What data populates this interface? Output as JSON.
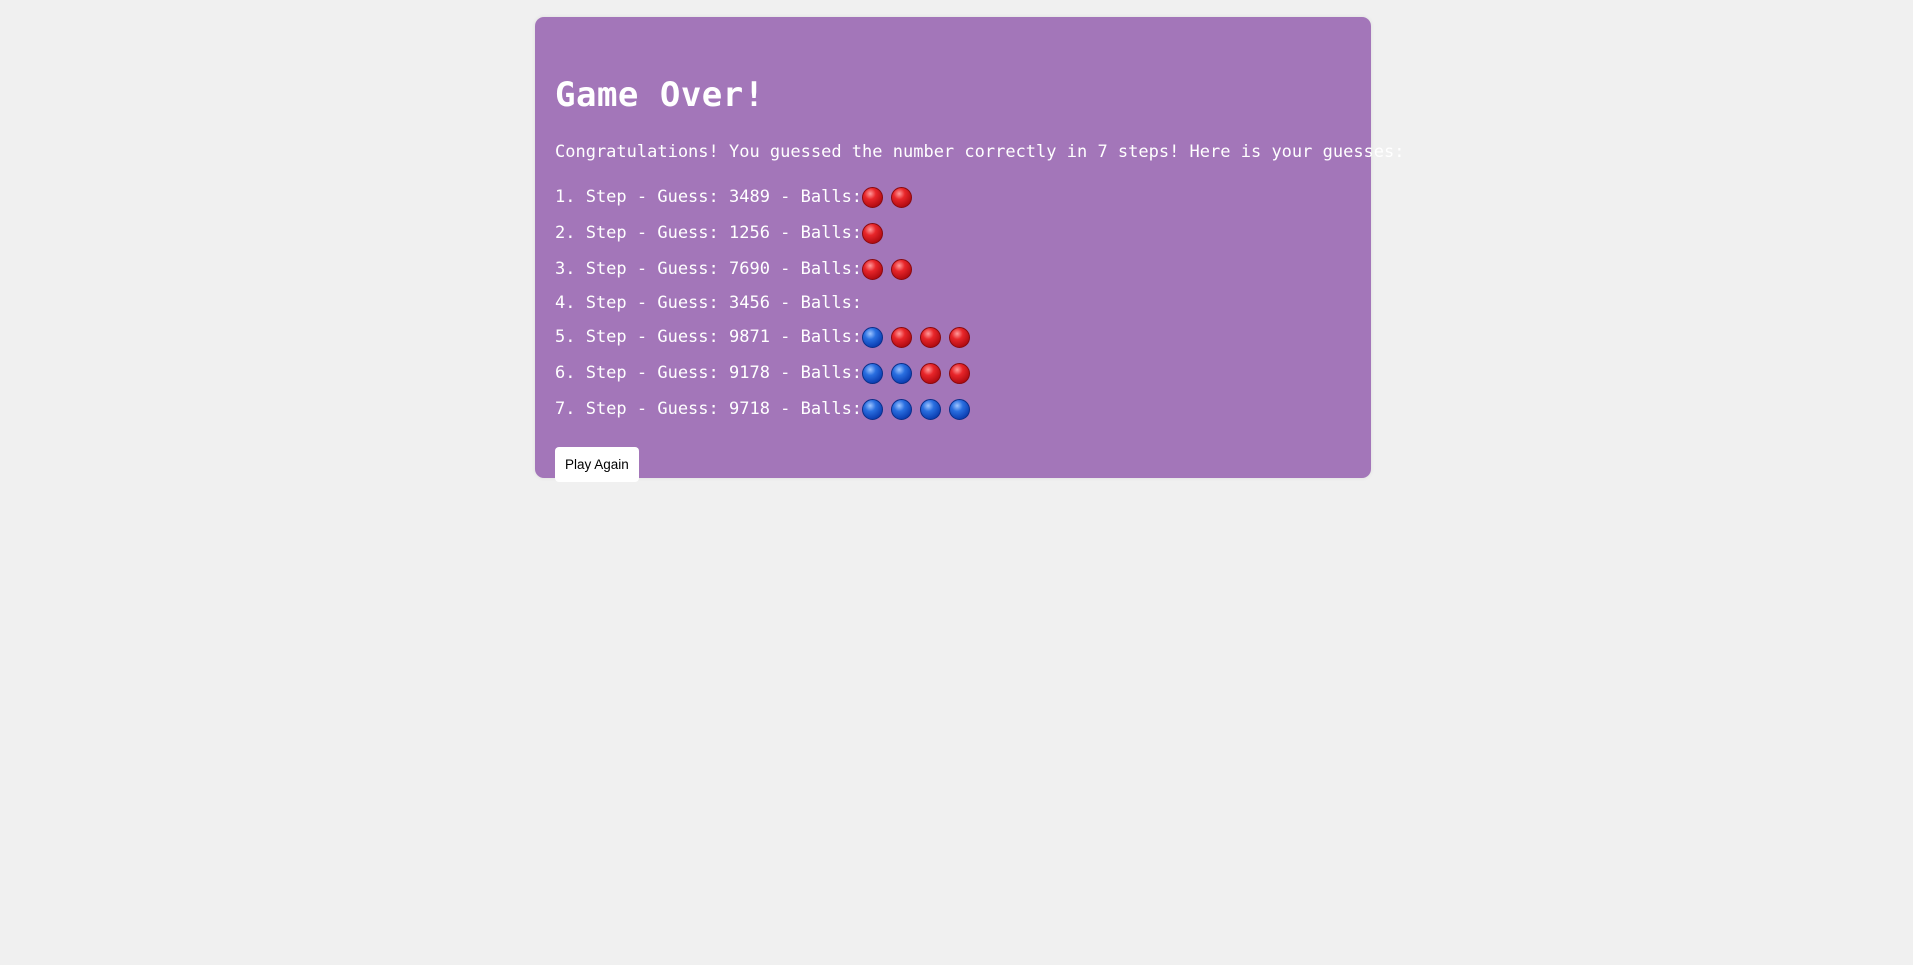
{
  "card": {
    "title": "Game Over!",
    "intro": "Congratulations! You guessed the number correctly in 7 steps! Here is your guesses:",
    "guesses": [
      {
        "label": "1. Step - Guess: 3489 - Balls:",
        "balls": [
          "red",
          "red"
        ]
      },
      {
        "label": "2. Step - Guess: 1256 - Balls:",
        "balls": [
          "red"
        ]
      },
      {
        "label": "3. Step - Guess: 7690 - Balls:",
        "balls": [
          "red",
          "red"
        ]
      },
      {
        "label": "4. Step - Guess: 3456 - Balls:",
        "balls": []
      },
      {
        "label": "5. Step - Guess: 9871 - Balls:",
        "balls": [
          "blue",
          "red",
          "red",
          "red"
        ]
      },
      {
        "label": "6. Step - Guess: 9178 - Balls:",
        "balls": [
          "blue",
          "blue",
          "red",
          "red"
        ]
      },
      {
        "label": "7. Step - Guess: 9718 - Balls:",
        "balls": [
          "blue",
          "blue",
          "blue",
          "blue"
        ]
      }
    ],
    "play_again_label": "Play Again"
  },
  "colors": {
    "page_background": "#f0f0f0",
    "card_background": "#a376b9",
    "text": "#ffffff",
    "red_ball": "#e8262a",
    "blue_ball": "#2a6fe0"
  },
  "icons": {
    "red": "red-ball-icon",
    "blue": "blue-ball-icon"
  }
}
